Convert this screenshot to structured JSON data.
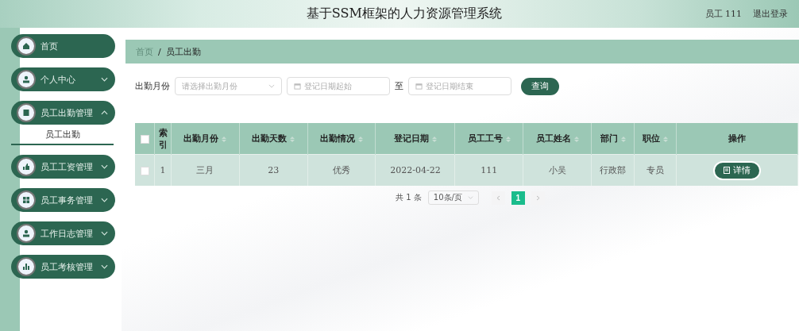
{
  "header": {
    "title": "基于SSM框架的人力资源管理系统",
    "user": "员工 111",
    "logout": "退出登录"
  },
  "sidebar": {
    "items": [
      {
        "label": "首页",
        "kind": "link"
      },
      {
        "label": "个人中心",
        "kind": "menu",
        "expanded": false
      },
      {
        "label": "员工出勤管理",
        "kind": "menu",
        "expanded": true,
        "children": [
          {
            "label": "员工出勤",
            "selected": true
          }
        ]
      },
      {
        "label": "员工工资管理",
        "kind": "menu",
        "expanded": false
      },
      {
        "label": "员工事务管理",
        "kind": "menu",
        "expanded": false
      },
      {
        "label": "工作日志管理",
        "kind": "menu",
        "expanded": false
      },
      {
        "label": "员工考核管理",
        "kind": "menu",
        "expanded": false
      }
    ]
  },
  "breadcrumb": {
    "separator": "/",
    "items": [
      "首页",
      "员工出勤"
    ]
  },
  "filters": {
    "month_label": "出勤月份",
    "month_placeholder": "请选择出勤月份",
    "date_from_placeholder": "登记日期起始",
    "to_label": "至",
    "date_to_placeholder": "登记日期结束",
    "search_button": "查询"
  },
  "table": {
    "columns": [
      {
        "label": "索引",
        "sortable": false
      },
      {
        "label": "出勤月份",
        "sortable": true
      },
      {
        "label": "出勤天数",
        "sortable": true
      },
      {
        "label": "出勤情况",
        "sortable": true
      },
      {
        "label": "登记日期",
        "sortable": true
      },
      {
        "label": "员工工号",
        "sortable": true
      },
      {
        "label": "员工姓名",
        "sortable": true
      },
      {
        "label": "部门",
        "sortable": true
      },
      {
        "label": "职位",
        "sortable": true
      },
      {
        "label": "操作",
        "sortable": false
      }
    ],
    "all_checked": false,
    "rows": [
      {
        "checked": false,
        "cells": [
          "1",
          "三月",
          "23",
          "优秀",
          "2022-04-22",
          "111",
          "小吴",
          "行政部",
          "专员"
        ],
        "action": "详情"
      }
    ]
  },
  "pagination": {
    "total": "共 1 条",
    "page_size": "10条/页",
    "pages": [
      {
        "label": "1",
        "selected": true
      }
    ]
  }
}
